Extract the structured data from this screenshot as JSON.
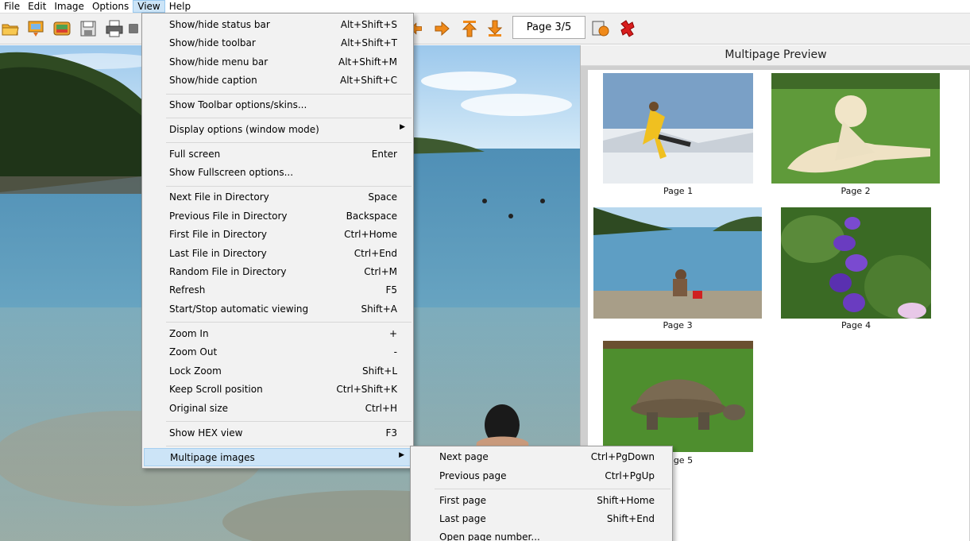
{
  "menubar": {
    "items": [
      "File",
      "Edit",
      "Image",
      "Options",
      "View",
      "Help"
    ]
  },
  "toolbar": {
    "page_indicator": "Page 3/5",
    "icons": [
      "open-folder-icon",
      "thumbnails-icon",
      "slideshow-icon",
      "save-icon",
      "print-icon",
      "scanner-icon",
      "previous-page-icon",
      "next-page-icon",
      "first-page-icon",
      "last-page-icon",
      "info-icon",
      "exit-icon"
    ]
  },
  "preview": {
    "title": "Multipage Preview",
    "pages": [
      {
        "label": "Page 1"
      },
      {
        "label": "Page 2"
      },
      {
        "label": "Page 3"
      },
      {
        "label": "Page 4"
      },
      {
        "label": "Page 5"
      }
    ]
  },
  "view_menu": {
    "items": [
      {
        "label": "Show/hide status bar",
        "shortcut": "Alt+Shift+S"
      },
      {
        "label": "Show/hide toolbar",
        "shortcut": "Alt+Shift+T"
      },
      {
        "label": "Show/hide menu bar",
        "shortcut": "Alt+Shift+M"
      },
      {
        "label": "Show/hide caption",
        "shortcut": "Alt+Shift+C"
      },
      {
        "label": "Show Toolbar options/skins...",
        "shortcut": ""
      },
      {
        "label": "Display options (window mode)",
        "shortcut": "",
        "submenu": true
      },
      {
        "label": "Full screen",
        "shortcut": "Enter"
      },
      {
        "label": "Show Fullscreen options...",
        "shortcut": ""
      },
      {
        "label": "Next File in Directory",
        "shortcut": "Space"
      },
      {
        "label": "Previous File in Directory",
        "shortcut": "Backspace"
      },
      {
        "label": "First File in Directory",
        "shortcut": "Ctrl+Home"
      },
      {
        "label": "Last File in Directory",
        "shortcut": "Ctrl+End"
      },
      {
        "label": "Random File in Directory",
        "shortcut": "Ctrl+M"
      },
      {
        "label": "Refresh",
        "shortcut": "F5"
      },
      {
        "label": "Start/Stop automatic viewing",
        "shortcut": "Shift+A"
      },
      {
        "label": "Zoom In",
        "shortcut": "+"
      },
      {
        "label": "Zoom Out",
        "shortcut": "-"
      },
      {
        "label": "Lock Zoom",
        "shortcut": "Shift+L"
      },
      {
        "label": "Keep Scroll position",
        "shortcut": "Ctrl+Shift+K"
      },
      {
        "label": "Original size",
        "shortcut": "Ctrl+H"
      },
      {
        "label": "Show HEX view",
        "shortcut": "F3"
      },
      {
        "label": "Multipage images",
        "shortcut": "",
        "submenu": true
      }
    ]
  },
  "multipage_submenu": {
    "items": [
      {
        "label": "Next page",
        "shortcut": "Ctrl+PgDown"
      },
      {
        "label": "Previous page",
        "shortcut": "Ctrl+PgUp"
      },
      {
        "label": "First page",
        "shortcut": "Shift+Home"
      },
      {
        "label": "Last page",
        "shortcut": "Shift+End"
      },
      {
        "label": "Open page number...",
        "shortcut": ""
      }
    ]
  }
}
